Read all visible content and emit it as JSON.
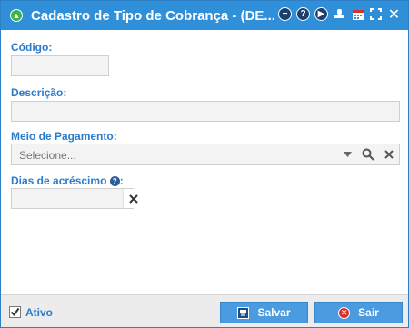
{
  "window": {
    "title": "Cadastro de Tipo de Cobrança - (DE...",
    "accent": "#2f8fd8",
    "tools": [
      "minus-circle-icon",
      "help-icon",
      "play-icon",
      "stamp-icon",
      "calendar-icon",
      "fullscreen-icon",
      "close-icon"
    ]
  },
  "form": {
    "codigo": {
      "label": "Código:",
      "value": ""
    },
    "descricao": {
      "label": "Descrição:",
      "value": ""
    },
    "meio_pagamento": {
      "label": "Meio de Pagamento:",
      "placeholder": "Selecione..."
    },
    "dias_acrescimo": {
      "label": "Dias de acréscimo",
      "suffix": ":",
      "value": ""
    }
  },
  "footer": {
    "ativo_label": "Ativo",
    "ativo_checked": true,
    "save_label": "Salvar",
    "exit_label": "Sair"
  }
}
